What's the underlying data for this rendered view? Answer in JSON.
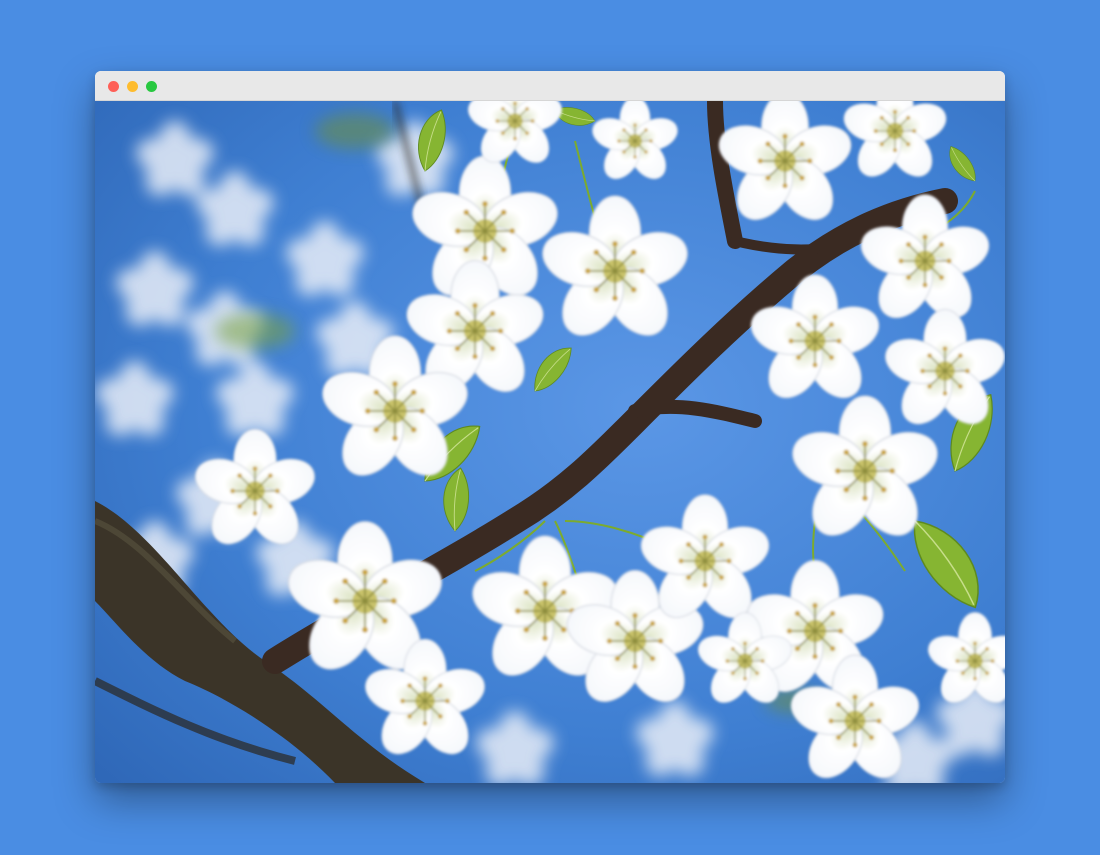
{
  "window": {
    "controls": [
      "close",
      "minimize",
      "maximize"
    ],
    "title": ""
  },
  "photo": {
    "subject": "cherry-blossom-branch",
    "colors": {
      "page_background": "#4a8de3",
      "sky": "#3f7fd2",
      "blossom": "#ffffff",
      "branch": "#3a2a22",
      "leaf": "#7fae2f"
    }
  }
}
